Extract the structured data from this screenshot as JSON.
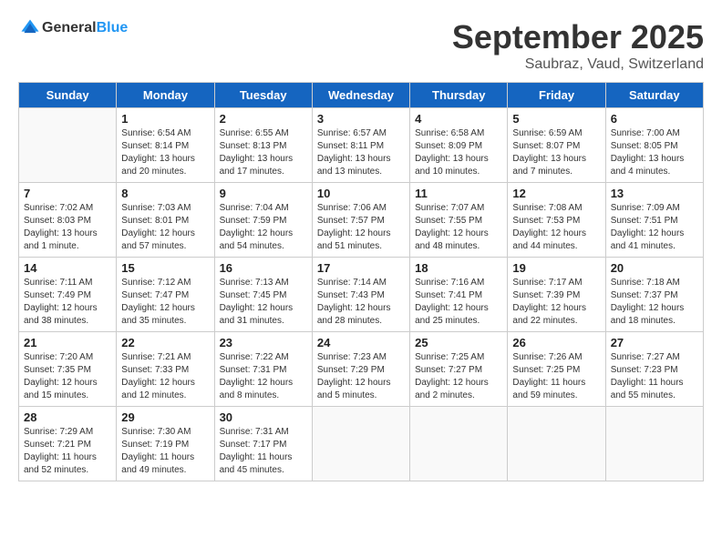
{
  "header": {
    "logo_general": "General",
    "logo_blue": "Blue",
    "month_title": "September 2025",
    "location": "Saubraz, Vaud, Switzerland"
  },
  "days_of_week": [
    "Sunday",
    "Monday",
    "Tuesday",
    "Wednesday",
    "Thursday",
    "Friday",
    "Saturday"
  ],
  "weeks": [
    [
      {
        "date": "",
        "info": ""
      },
      {
        "date": "1",
        "info": "Sunrise: 6:54 AM\nSunset: 8:14 PM\nDaylight: 13 hours\nand 20 minutes."
      },
      {
        "date": "2",
        "info": "Sunrise: 6:55 AM\nSunset: 8:13 PM\nDaylight: 13 hours\nand 17 minutes."
      },
      {
        "date": "3",
        "info": "Sunrise: 6:57 AM\nSunset: 8:11 PM\nDaylight: 13 hours\nand 13 minutes."
      },
      {
        "date": "4",
        "info": "Sunrise: 6:58 AM\nSunset: 8:09 PM\nDaylight: 13 hours\nand 10 minutes."
      },
      {
        "date": "5",
        "info": "Sunrise: 6:59 AM\nSunset: 8:07 PM\nDaylight: 13 hours\nand 7 minutes."
      },
      {
        "date": "6",
        "info": "Sunrise: 7:00 AM\nSunset: 8:05 PM\nDaylight: 13 hours\nand 4 minutes."
      }
    ],
    [
      {
        "date": "7",
        "info": "Sunrise: 7:02 AM\nSunset: 8:03 PM\nDaylight: 13 hours\nand 1 minute."
      },
      {
        "date": "8",
        "info": "Sunrise: 7:03 AM\nSunset: 8:01 PM\nDaylight: 12 hours\nand 57 minutes."
      },
      {
        "date": "9",
        "info": "Sunrise: 7:04 AM\nSunset: 7:59 PM\nDaylight: 12 hours\nand 54 minutes."
      },
      {
        "date": "10",
        "info": "Sunrise: 7:06 AM\nSunset: 7:57 PM\nDaylight: 12 hours\nand 51 minutes."
      },
      {
        "date": "11",
        "info": "Sunrise: 7:07 AM\nSunset: 7:55 PM\nDaylight: 12 hours\nand 48 minutes."
      },
      {
        "date": "12",
        "info": "Sunrise: 7:08 AM\nSunset: 7:53 PM\nDaylight: 12 hours\nand 44 minutes."
      },
      {
        "date": "13",
        "info": "Sunrise: 7:09 AM\nSunset: 7:51 PM\nDaylight: 12 hours\nand 41 minutes."
      }
    ],
    [
      {
        "date": "14",
        "info": "Sunrise: 7:11 AM\nSunset: 7:49 PM\nDaylight: 12 hours\nand 38 minutes."
      },
      {
        "date": "15",
        "info": "Sunrise: 7:12 AM\nSunset: 7:47 PM\nDaylight: 12 hours\nand 35 minutes."
      },
      {
        "date": "16",
        "info": "Sunrise: 7:13 AM\nSunset: 7:45 PM\nDaylight: 12 hours\nand 31 minutes."
      },
      {
        "date": "17",
        "info": "Sunrise: 7:14 AM\nSunset: 7:43 PM\nDaylight: 12 hours\nand 28 minutes."
      },
      {
        "date": "18",
        "info": "Sunrise: 7:16 AM\nSunset: 7:41 PM\nDaylight: 12 hours\nand 25 minutes."
      },
      {
        "date": "19",
        "info": "Sunrise: 7:17 AM\nSunset: 7:39 PM\nDaylight: 12 hours\nand 22 minutes."
      },
      {
        "date": "20",
        "info": "Sunrise: 7:18 AM\nSunset: 7:37 PM\nDaylight: 12 hours\nand 18 minutes."
      }
    ],
    [
      {
        "date": "21",
        "info": "Sunrise: 7:20 AM\nSunset: 7:35 PM\nDaylight: 12 hours\nand 15 minutes."
      },
      {
        "date": "22",
        "info": "Sunrise: 7:21 AM\nSunset: 7:33 PM\nDaylight: 12 hours\nand 12 minutes."
      },
      {
        "date": "23",
        "info": "Sunrise: 7:22 AM\nSunset: 7:31 PM\nDaylight: 12 hours\nand 8 minutes."
      },
      {
        "date": "24",
        "info": "Sunrise: 7:23 AM\nSunset: 7:29 PM\nDaylight: 12 hours\nand 5 minutes."
      },
      {
        "date": "25",
        "info": "Sunrise: 7:25 AM\nSunset: 7:27 PM\nDaylight: 12 hours\nand 2 minutes."
      },
      {
        "date": "26",
        "info": "Sunrise: 7:26 AM\nSunset: 7:25 PM\nDaylight: 11 hours\nand 59 minutes."
      },
      {
        "date": "27",
        "info": "Sunrise: 7:27 AM\nSunset: 7:23 PM\nDaylight: 11 hours\nand 55 minutes."
      }
    ],
    [
      {
        "date": "28",
        "info": "Sunrise: 7:29 AM\nSunset: 7:21 PM\nDaylight: 11 hours\nand 52 minutes."
      },
      {
        "date": "29",
        "info": "Sunrise: 7:30 AM\nSunset: 7:19 PM\nDaylight: 11 hours\nand 49 minutes."
      },
      {
        "date": "30",
        "info": "Sunrise: 7:31 AM\nSunset: 7:17 PM\nDaylight: 11 hours\nand 45 minutes."
      },
      {
        "date": "",
        "info": ""
      },
      {
        "date": "",
        "info": ""
      },
      {
        "date": "",
        "info": ""
      },
      {
        "date": "",
        "info": ""
      }
    ]
  ]
}
